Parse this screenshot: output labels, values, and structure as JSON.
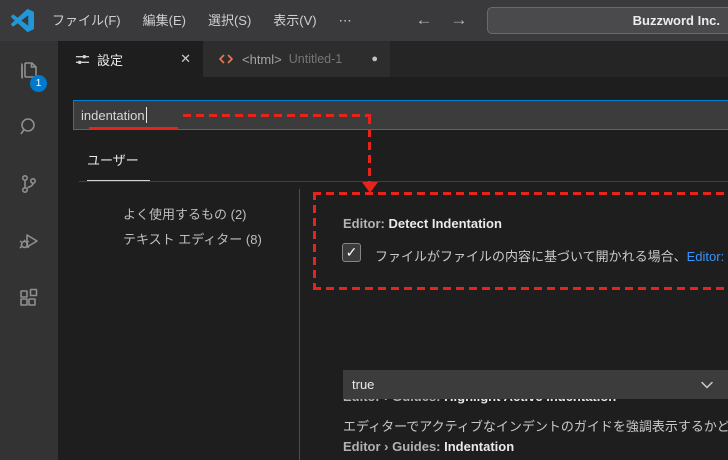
{
  "title_bar": {
    "menu_items": [
      {
        "label": "ファイル(F)"
      },
      {
        "label": "編集(E)"
      },
      {
        "label": "選択(S)"
      },
      {
        "label": "表示(V)"
      },
      {
        "label": "⋯"
      }
    ],
    "back_arrow": "←",
    "forward_arrow": "→",
    "command_center_text": "Buzzword Inc."
  },
  "activity_bar": {
    "explorer_badge": "1",
    "items": [
      "explorer",
      "search",
      "source-control",
      "run-and-debug",
      "extensions"
    ]
  },
  "tab_bar": {
    "settings_tab": {
      "label": "設定",
      "close_glyph": "✕"
    },
    "html_tab": {
      "label": "<html>",
      "description": "Untitled-1",
      "dirty_glyph": "●"
    }
  },
  "settings_editor": {
    "search_value": "indentation",
    "scope_tab": "ユーザー",
    "toc": [
      {
        "label": "よく使用するもの (2)"
      },
      {
        "label": "テキスト エディター (8)"
      }
    ],
    "detect_indentation": {
      "category": "Editor: ",
      "name": "Detect Indentation",
      "checked": true,
      "check_glyph": "✓",
      "description": "ファイルがファイルの内容に基づいて開かれる場合、",
      "description_link": "Editor:"
    },
    "highlight_active_indentation": {
      "category": "Editor › Guides: ",
      "name": "Highlight Active Indentation",
      "description": "エディターでアクティブなインデントのガイドを強調表示するかどうか",
      "value": "true"
    },
    "guides_indentation": {
      "category": "Editor › Guides: ",
      "name": "Indentation"
    }
  },
  "colors": {
    "annotation_red": "#e8231c",
    "focus_border_blue": "#007fd4",
    "badge_blue": "#007acc",
    "link_blue": "#3794ff",
    "html_icon_orange": "#e8774e",
    "logo_blue": "#2196d9"
  }
}
